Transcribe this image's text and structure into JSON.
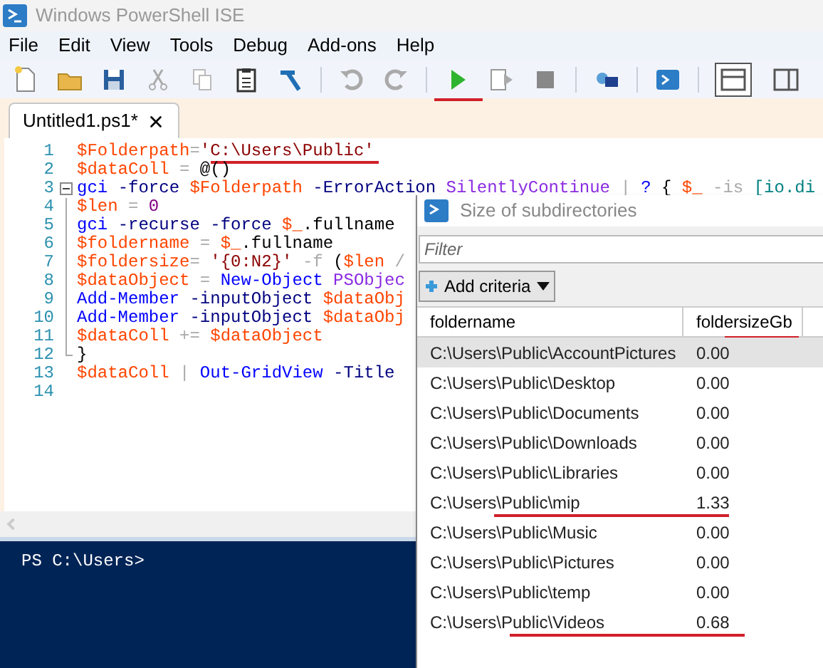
{
  "window": {
    "title": "Windows PowerShell ISE"
  },
  "menu": [
    "File",
    "Edit",
    "View",
    "Tools",
    "Debug",
    "Add-ons",
    "Help"
  ],
  "layout_toggles": [
    {
      "selected": true
    },
    {
      "selected": false
    }
  ],
  "tabs": [
    {
      "label": "Untitled1.ps1*",
      "selected": true
    }
  ],
  "editor": {
    "lines": [
      {
        "number": "1",
        "tokens": [
          {
            "kind": "var",
            "text": "$Folderpath"
          },
          {
            "kind": "op",
            "text": "="
          },
          {
            "kind": "str",
            "text": "'C:\\Users\\Public'"
          }
        ]
      },
      {
        "number": "2",
        "tokens": [
          {
            "kind": "var",
            "text": "$dataColl"
          },
          {
            "kind": "op",
            "text": " = "
          },
          {
            "kind": "plain",
            "text": "@()"
          }
        ]
      },
      {
        "number": "3",
        "collapsible": true,
        "tokens": [
          {
            "kind": "cmd",
            "text": "gci "
          },
          {
            "kind": "param",
            "text": "-force "
          },
          {
            "kind": "var",
            "text": "$Folderpath "
          },
          {
            "kind": "param",
            "text": "-ErrorAction "
          },
          {
            "kind": "arg",
            "text": "SilentlyContinue "
          },
          {
            "kind": "op",
            "text": "| "
          },
          {
            "kind": "cmd",
            "text": "? "
          },
          {
            "kind": "plain",
            "text": "{ "
          },
          {
            "kind": "var",
            "text": "$_ "
          },
          {
            "kind": "op",
            "text": "-is "
          },
          {
            "kind": "type",
            "text": "[io.di"
          }
        ]
      },
      {
        "number": "4",
        "in_block": true,
        "tokens": [
          {
            "kind": "var",
            "text": "$len"
          },
          {
            "kind": "op",
            "text": " = "
          },
          {
            "kind": "num",
            "text": "0"
          }
        ]
      },
      {
        "number": "5",
        "in_block": true,
        "tokens": [
          {
            "kind": "cmd",
            "text": "gci "
          },
          {
            "kind": "param",
            "text": "-recurse "
          },
          {
            "kind": "param",
            "text": "-force "
          },
          {
            "kind": "var",
            "text": "$_"
          },
          {
            "kind": "plain",
            "text": ".fullname"
          }
        ]
      },
      {
        "number": "6",
        "in_block": true,
        "tokens": [
          {
            "kind": "var",
            "text": "$foldername"
          },
          {
            "kind": "op",
            "text": " = "
          },
          {
            "kind": "var",
            "text": "$_"
          },
          {
            "kind": "plain",
            "text": ".fullname"
          }
        ]
      },
      {
        "number": "7",
        "in_block": true,
        "tokens": [
          {
            "kind": "var",
            "text": "$foldersize"
          },
          {
            "kind": "op",
            "text": "= "
          },
          {
            "kind": "str",
            "text": "'{0:N2}' "
          },
          {
            "kind": "op",
            "text": "-f "
          },
          {
            "kind": "plain",
            "text": "("
          },
          {
            "kind": "var",
            "text": "$len "
          },
          {
            "kind": "op",
            "text": "/"
          }
        ]
      },
      {
        "number": "8",
        "in_block": true,
        "tokens": [
          {
            "kind": "var",
            "text": "$dataObject"
          },
          {
            "kind": "op",
            "text": " = "
          },
          {
            "kind": "cmd",
            "text": "New-Object "
          },
          {
            "kind": "arg",
            "text": "PSObjec"
          }
        ]
      },
      {
        "number": "9",
        "in_block": true,
        "tokens": [
          {
            "kind": "cmd",
            "text": "Add-Member "
          },
          {
            "kind": "param",
            "text": "-inputObject "
          },
          {
            "kind": "var",
            "text": "$dataObj"
          }
        ]
      },
      {
        "number": "10",
        "in_block": true,
        "tokens": [
          {
            "kind": "cmd",
            "text": "Add-Member "
          },
          {
            "kind": "param",
            "text": "-inputObject "
          },
          {
            "kind": "var",
            "text": "$dataObj"
          }
        ]
      },
      {
        "number": "11",
        "in_block": true,
        "tokens": [
          {
            "kind": "var",
            "text": "$dataColl"
          },
          {
            "kind": "op",
            "text": " += "
          },
          {
            "kind": "var",
            "text": "$dataObject"
          }
        ]
      },
      {
        "number": "12",
        "block_end": true,
        "tokens": [
          {
            "kind": "plain",
            "text": "}"
          }
        ]
      },
      {
        "number": "13",
        "tokens": [
          {
            "kind": "var",
            "text": "$dataColl"
          },
          {
            "kind": "op",
            "text": " | "
          },
          {
            "kind": "cmd",
            "text": "Out-GridView "
          },
          {
            "kind": "param",
            "text": "-Title"
          }
        ]
      },
      {
        "number": "14"
      }
    ]
  },
  "console": {
    "prompt": "PS C:\\Users>"
  },
  "dialog": {
    "title": "Size of subdirectories",
    "filter": {
      "placeholder": "Filter"
    },
    "add_criteria": "Add criteria",
    "columns": [
      "foldername",
      "foldersizeGb"
    ],
    "rows": [
      {
        "foldername": "C:\\Users\\Public\\AccountPictures",
        "size": "0.00",
        "selected": true
      },
      {
        "foldername": "C:\\Users\\Public\\Desktop",
        "size": "0.00",
        "selected": false
      },
      {
        "foldername": "C:\\Users\\Public\\Documents",
        "size": "0.00",
        "selected": false
      },
      {
        "foldername": "C:\\Users\\Public\\Downloads",
        "size": "0.00",
        "selected": false
      },
      {
        "foldername": "C:\\Users\\Public\\Libraries",
        "size": "0.00",
        "selected": false
      },
      {
        "foldername": "C:\\Users\\Public\\mip",
        "size": "1.33",
        "selected": false
      },
      {
        "foldername": "C:\\Users\\Public\\Music",
        "size": "0.00",
        "selected": false
      },
      {
        "foldername": "C:\\Users\\Public\\Pictures",
        "size": "0.00",
        "selected": false
      },
      {
        "foldername": "C:\\Users\\Public\\temp",
        "size": "0.00",
        "selected": false
      },
      {
        "foldername": "C:\\Users\\Public\\Videos",
        "size": "0.68",
        "selected": false
      }
    ]
  }
}
